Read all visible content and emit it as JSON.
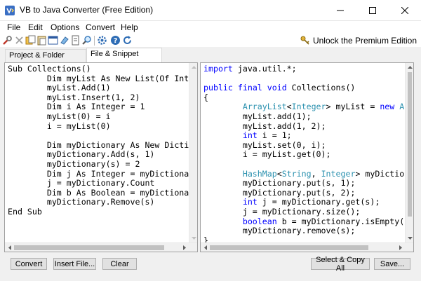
{
  "window": {
    "title": "VB to Java Converter (Free Edition)"
  },
  "menu": [
    "File",
    "Edit",
    "Options",
    "Convert",
    "Help"
  ],
  "toolbar": {
    "icons": [
      "wrench-icon",
      "cut-icon",
      "copy-icon",
      "paste-icon",
      "window-icon",
      "eraser-icon",
      "document-icon",
      "find-icon",
      "settings-icon",
      "help-icon",
      "refresh-icon"
    ],
    "premium_label": "Unlock the Premium Edition"
  },
  "tabs": [
    {
      "label": "Project & Folder Converter",
      "active": false
    },
    {
      "label": "File & Snippet Converter",
      "active": true
    }
  ],
  "vb_code": [
    "Sub Collections()",
    "        Dim myList As New List(Of Integer)()",
    "        myList.Add(1)",
    "        myList.Insert(1, 2)",
    "        Dim i As Integer = 1",
    "        myList(0) = i",
    "        i = myList(0)",
    "",
    "        Dim myDictionary As New Dictionary(Of",
    "        myDictionary.Add(s, 1)",
    "        myDictionary(s) = 2",
    "        Dim j As Integer = myDictionary(s)",
    "        j = myDictionary.Count",
    "        Dim b As Boolean = myDictionary.Count",
    "        myDictionary.Remove(s)",
    "End Sub"
  ],
  "java_code": [
    "import java.util.*;",
    "",
    "public final void Collections()",
    "{",
    "        ArrayList<Integer> myList = new ArrayList",
    "        myList.add(1);",
    "        myList.add(1, 2);",
    "        int i = 1;",
    "        myList.set(0, i);",
    "        i = myList.get(0);",
    "",
    "        HashMap<String, Integer> myDictionary = n",
    "        myDictionary.put(s, 1);",
    "        myDictionary.put(s, 2);",
    "        int j = myDictionary.get(s);",
    "        j = myDictionary.size();",
    "        boolean b = myDictionary.isEmpty();",
    "        myDictionary.remove(s);",
    "}"
  ],
  "buttons": {
    "convert": "Convert",
    "insert_file": "Insert File...",
    "clear": "Clear",
    "select_copy_all": "Select & Copy All",
    "save": "Save..."
  },
  "colors": {
    "keyword": "#0000ff",
    "type": "#2b91af"
  }
}
